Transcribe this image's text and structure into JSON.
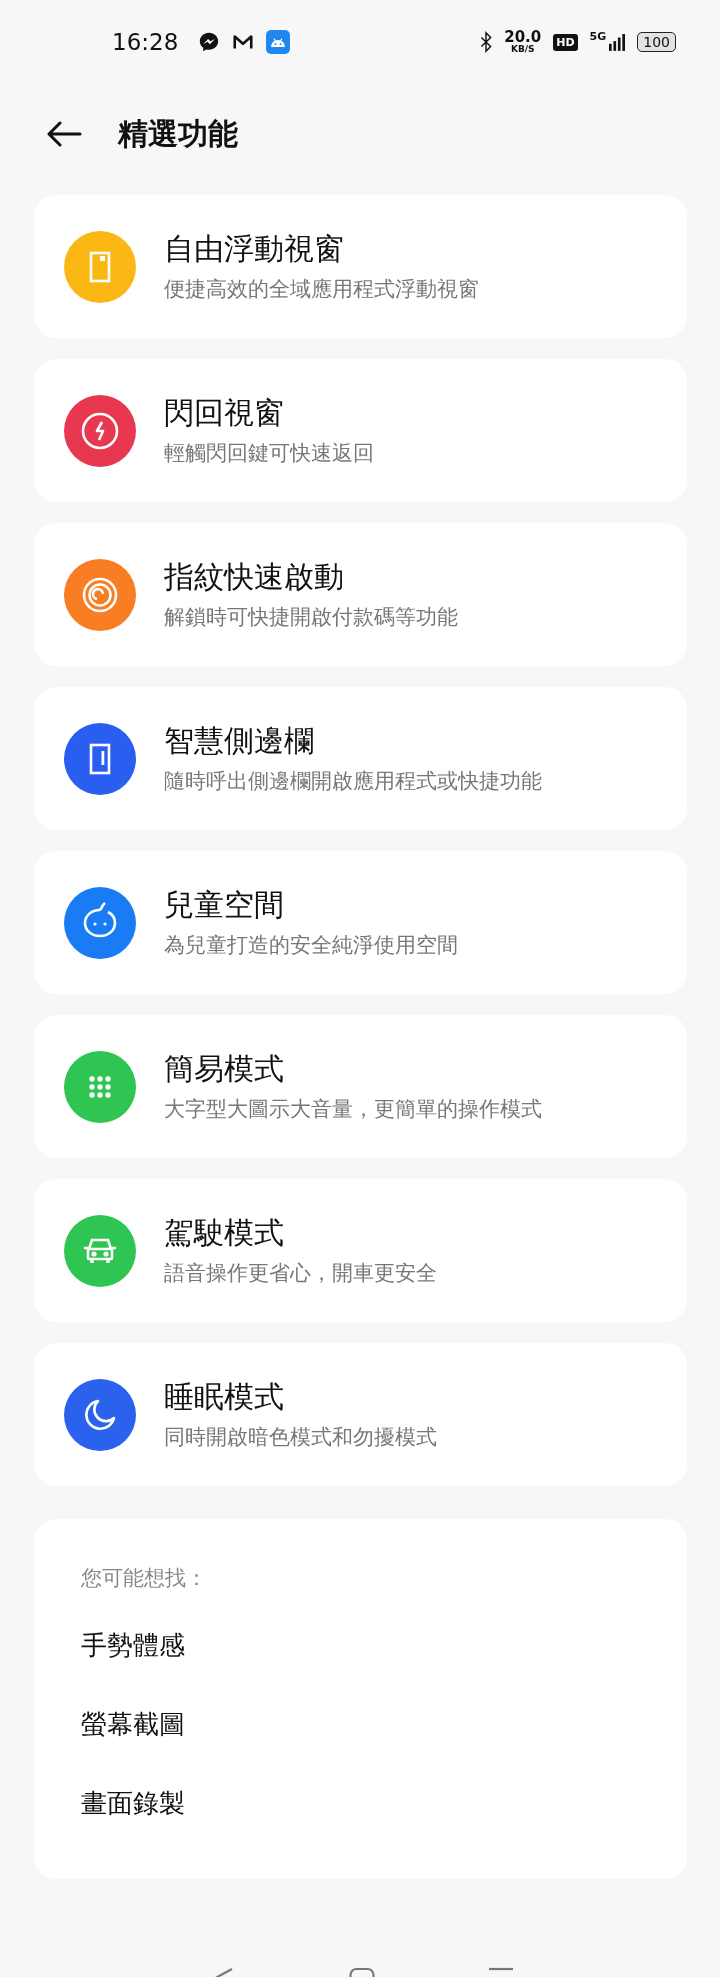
{
  "status_bar": {
    "time": "16:28",
    "speed": "20.0",
    "speed_unit": "KB/S",
    "hd": "HD",
    "network": "5G",
    "battery": "100"
  },
  "header": {
    "title": "精選功能"
  },
  "features": [
    {
      "kind": "window",
      "color": "#fbb714",
      "title": "自由浮動視窗",
      "subtitle": "便捷高效的全域應用程式浮動視窗"
    },
    {
      "kind": "flash",
      "color": "#e8384f",
      "title": "閃回視窗",
      "subtitle": "輕觸閃回鍵可快速返回"
    },
    {
      "kind": "fingerprint",
      "color": "#f97d22",
      "title": "指紋快速啟動",
      "subtitle": "解鎖時可快捷開啟付款碼等功能"
    },
    {
      "kind": "sidebar",
      "color": "#2a5ef0",
      "title": "智慧側邊欄",
      "subtitle": "隨時呼出側邊欄開啟應用程式或快捷功能"
    },
    {
      "kind": "child",
      "color": "#1a7cf5",
      "title": "兒童空間",
      "subtitle": "為兒童打造的安全純淨使用空間"
    },
    {
      "kind": "grid",
      "color": "#2fc552",
      "title": "簡易模式",
      "subtitle": "大字型大圖示大音量，更簡單的操作模式"
    },
    {
      "kind": "car",
      "color": "#2fc552",
      "title": "駕駛模式",
      "subtitle": "語音操作更省心，開車更安全"
    },
    {
      "kind": "moon",
      "color": "#2a62ee",
      "title": "睡眠模式",
      "subtitle": "同時開啟暗色模式和勿擾模式"
    }
  ],
  "suggestions": {
    "label": "您可能想找：",
    "items": [
      "手勢體感",
      "螢幕截圖",
      "畫面錄製"
    ]
  }
}
